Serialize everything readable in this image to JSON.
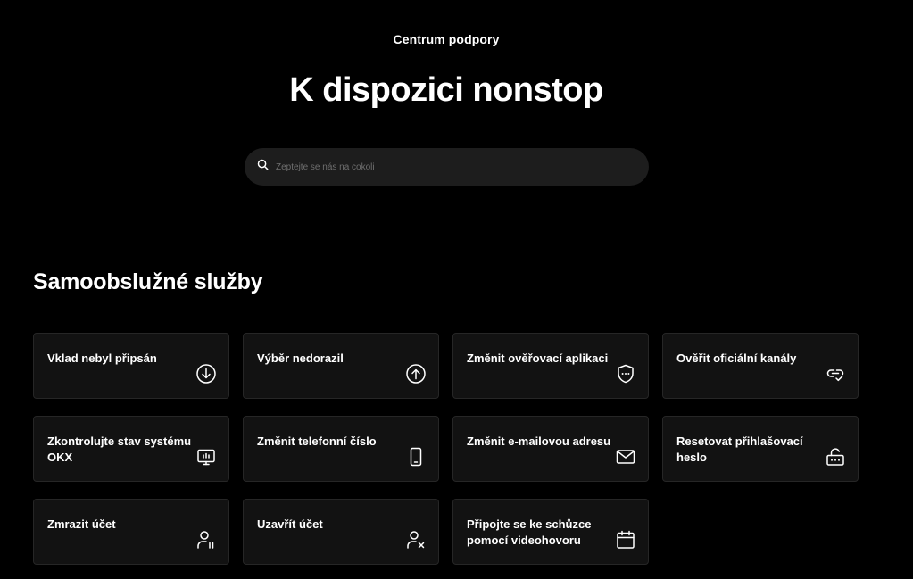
{
  "header": {
    "eyebrow": "Centrum podpory",
    "title": "K dispozici nonstop"
  },
  "search": {
    "placeholder": "Zeptejte se nás na cokoli",
    "value": "",
    "icon": "search-icon"
  },
  "section": {
    "title": "Samoobslužné služby"
  },
  "cards": [
    {
      "label": "Vklad nebyl připsán",
      "icon": "download-icon"
    },
    {
      "label": "Výběr nedorazil",
      "icon": "upload-icon"
    },
    {
      "label": "Změnit ověřovací aplikaci",
      "icon": "shield-password-icon"
    },
    {
      "label": "Ověřit oficiální kanály",
      "icon": "link-check-icon"
    },
    {
      "label": "Zkontrolujte stav systému OKX",
      "icon": "monitor-status-icon"
    },
    {
      "label": "Změnit telefonní číslo",
      "icon": "phone-icon"
    },
    {
      "label": "Změnit e-mailovou adresu",
      "icon": "mail-icon"
    },
    {
      "label": "Resetovat přihlašovací heslo",
      "icon": "unlock-password-icon"
    },
    {
      "label": "Zmrazit účet",
      "icon": "user-pause-icon"
    },
    {
      "label": "Uzavřít účet",
      "icon": "user-remove-icon"
    },
    {
      "label": "Připojte se ke schůzce pomocí videohovoru",
      "icon": "calendar-icon"
    }
  ]
}
